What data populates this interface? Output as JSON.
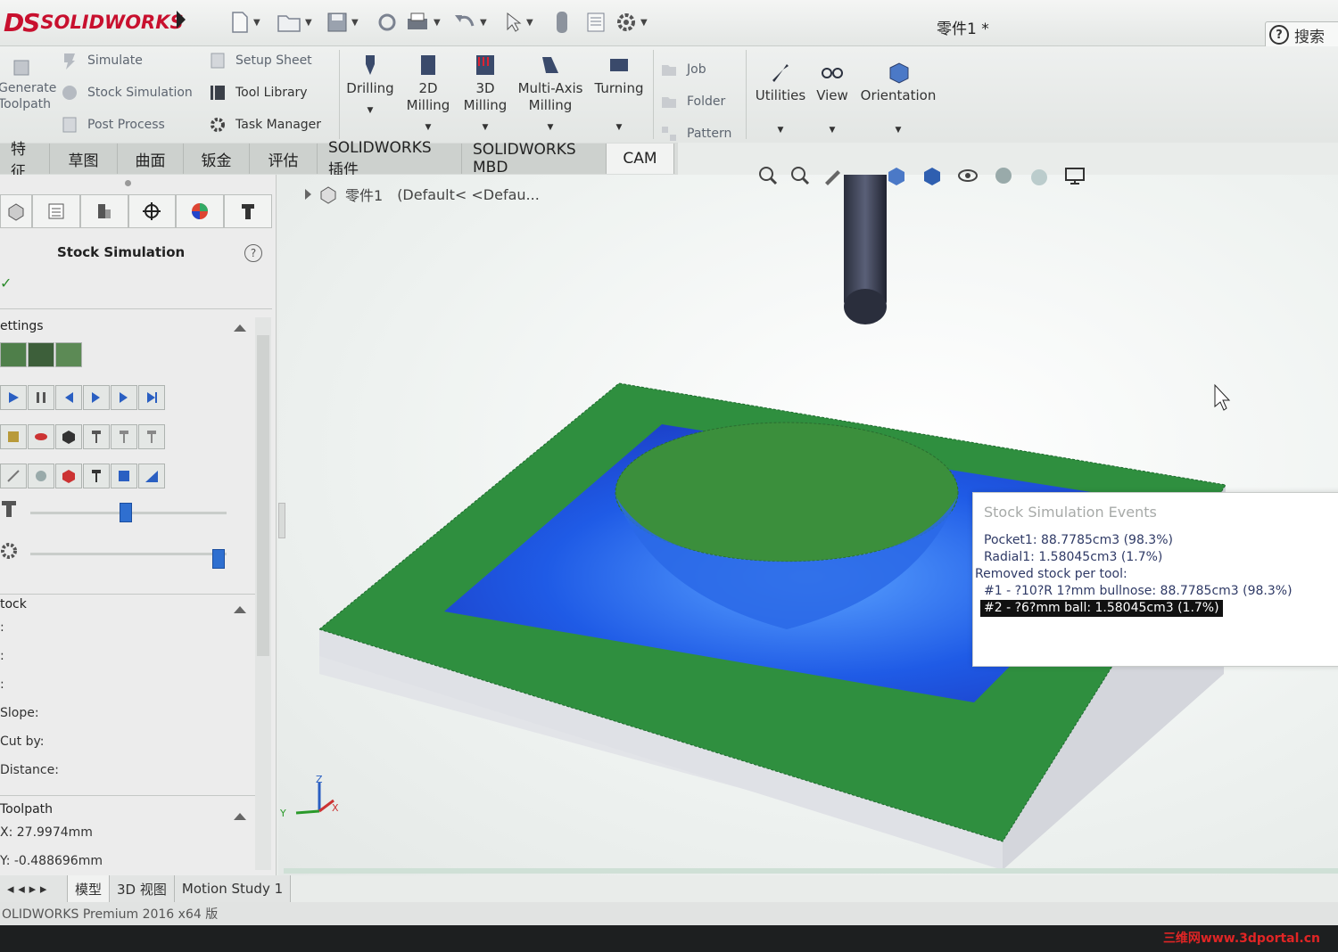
{
  "app": {
    "brand": "SOLIDWORKS",
    "brand_mark": "DS",
    "document_title": "零件1 *",
    "search_label": "搜索",
    "help_symbol": "?"
  },
  "ribbon": {
    "left_group": {
      "generate_toolpath": "Generate\nToolpath",
      "simulate": "Simulate",
      "stock_simulation": "Stock Simulation",
      "post_process": "Post Process",
      "setup_sheet": "Setup Sheet",
      "tool_library": "Tool Library",
      "task_manager": "Task Manager"
    },
    "big_buttons": [
      {
        "label": "Drilling"
      },
      {
        "label": "2D\nMilling"
      },
      {
        "label": "3D\nMilling"
      },
      {
        "label": "Multi-Axis\nMilling"
      },
      {
        "label": "Turning"
      }
    ],
    "job_group": {
      "job": "Job",
      "folder": "Folder",
      "pattern": "Pattern"
    },
    "right_buttons": [
      {
        "label": "Utilities"
      },
      {
        "label": "View"
      },
      {
        "label": "Orientation"
      }
    ]
  },
  "tabs": [
    "特征",
    "草图",
    "曲面",
    "钣金",
    "评估",
    "SOLIDWORKS 插件",
    "SOLIDWORKS MBD",
    "CAM"
  ],
  "active_tab": "CAM",
  "left_panel": {
    "title": "Stock Simulation",
    "settings_header": "ettings",
    "stock_header": "tock",
    "stock_fields": [
      ":",
      ":",
      ":"
    ],
    "slope_label": "Slope:",
    "cut_by_label": "Cut by:",
    "distance_label": "Distance:",
    "toolpath_header": "Toolpath",
    "toolpath_x": "X: 27.9974mm",
    "toolpath_y": "Y: -0.488696mm",
    "slider1_position_pct": 49,
    "slider2_position_pct": 95
  },
  "viewport": {
    "tree_item": "零件1",
    "config_text": "(Default< <Defau..."
  },
  "events": {
    "title": "Stock Simulation Events",
    "lines": [
      "Pocket1: 88.7785cm3 (98.3%)",
      "Radial1: 1.58045cm3 (1.7%)",
      "Removed stock per tool:",
      "#1 - ?10?R 1?mm bullnose: 88.7785cm3 (98.3%)",
      "#2 - ?6?mm ball: 1.58045cm3 (1.7%)"
    ]
  },
  "bottom_tabs": [
    "模型",
    "3D 视图",
    "Motion Study 1"
  ],
  "status_bar": "OLIDWORKS Premium 2016 x64 版",
  "watermark": "三维网www.3dportal.cn",
  "colors": {
    "stock_green": "#2f8f3f",
    "cut_blue": "#1d4fe0",
    "brand_red": "#c8102e",
    "tab_active": "#f2f3f2"
  }
}
